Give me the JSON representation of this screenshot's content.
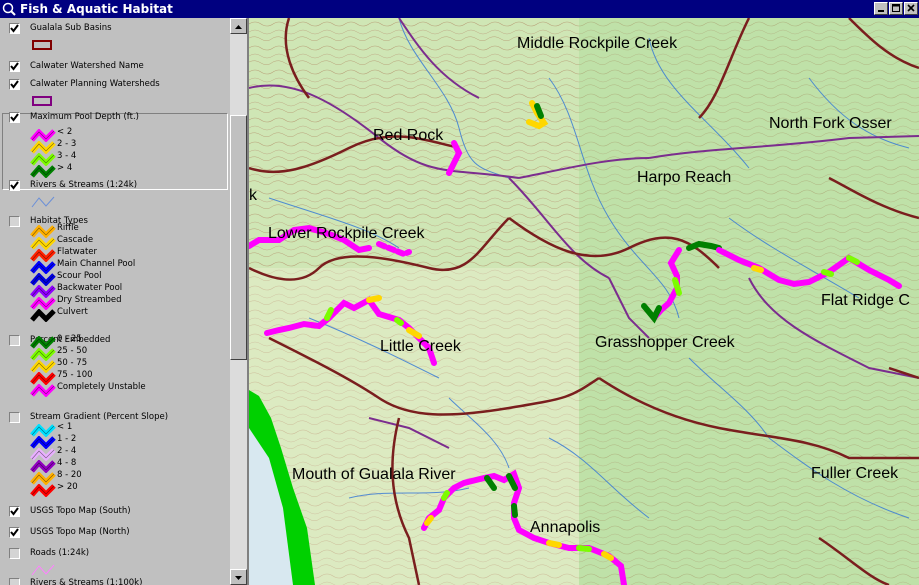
{
  "window": {
    "title": "Fish & Aquatic Habitat"
  },
  "legend": {
    "layers": [
      {
        "name": "Gualala Sub Basins",
        "checked": true,
        "symbol": "polygon",
        "color": "#800000"
      },
      {
        "name": "Calwater Watershed Name",
        "checked": true
      },
      {
        "name": "Calwater Planning Watersheds",
        "checked": true,
        "symbol": "polygon",
        "color": "#800080"
      },
      {
        "name": "Maximum Pool Depth (ft.)",
        "checked": true,
        "items": [
          {
            "label": "< 2",
            "color": "#ff00ff"
          },
          {
            "label": "2 - 3",
            "color": "#ffd700"
          },
          {
            "label": "3 - 4",
            "color": "#7cfc00"
          },
          {
            "label": "> 4",
            "color": "#008000"
          }
        ]
      },
      {
        "name": "Rivers & Streams (1:24k)",
        "checked": true,
        "symbol": "line",
        "color": "#6a8fd8"
      },
      {
        "name": "Habitat Types",
        "checked": false,
        "items": [
          {
            "label": "Riffle",
            "color": "#ffb000"
          },
          {
            "label": "Cascade",
            "color": "#ffd700"
          },
          {
            "label": "Flatwater",
            "color": "#ff2000"
          },
          {
            "label": "Main Channel Pool",
            "color": "#0000ff"
          },
          {
            "label": "Scour Pool",
            "color": "#0000e0"
          },
          {
            "label": "Backwater Pool",
            "color": "#9000ff"
          },
          {
            "label": "Dry Streambed",
            "color": "#ff00ff"
          },
          {
            "label": "Culvert",
            "color": "#000000"
          }
        ]
      },
      {
        "name": "Percent Embedded",
        "checked": false,
        "items": [
          {
            "label": "0 - 25",
            "color": "#008000"
          },
          {
            "label": "25 - 50",
            "color": "#7cfc00"
          },
          {
            "label": "50 - 75",
            "color": "#ffd700"
          },
          {
            "label": "75 - 100",
            "color": "#ff0000"
          },
          {
            "label": "Completely Unstable",
            "color": "#ff00ff"
          }
        ]
      },
      {
        "name": "Stream Gradient (Percent Slope)",
        "checked": false,
        "items": [
          {
            "label": "< 1",
            "color": "#00e0ff"
          },
          {
            "label": "1 - 2",
            "color": "#0000ff"
          },
          {
            "label": "2 - 4",
            "color": "#e8b0ff"
          },
          {
            "label": "4 - 8",
            "color": "#9000c0"
          },
          {
            "label": "8 - 20",
            "color": "#ffb000"
          },
          {
            "label": "> 20",
            "color": "#ff0000"
          }
        ]
      },
      {
        "name": "USGS Topo Map (South)",
        "checked": true
      },
      {
        "name": "USGS Topo Map (North)",
        "checked": true
      },
      {
        "name": "Roads (1:24k)",
        "checked": false,
        "symbol": "line",
        "color": "#ff80ff"
      },
      {
        "name": "Rivers & Streams (1:100k)",
        "checked": false
      }
    ]
  },
  "map": {
    "labels": [
      {
        "text": "Middle Rockpile Creek"
      },
      {
        "text": "Red Rock"
      },
      {
        "text": "North Fork Osser"
      },
      {
        "text": "Harpo Reach"
      },
      {
        "text": "k"
      },
      {
        "text": "Lower Rockpile Creek"
      },
      {
        "text": "Flat Ridge C"
      },
      {
        "text": "Grasshopper Creek"
      },
      {
        "text": "Little Creek"
      },
      {
        "text": "Mouth of Gualala River"
      },
      {
        "text": "Fuller Creek"
      },
      {
        "text": "Annapolis"
      }
    ],
    "colors": {
      "land": "#cfe6b5",
      "subbasin": "#7a1e1e",
      "watershed": "#7b2d8e",
      "stream": "#3a7bd5",
      "ocean_shore": "#00d000",
      "ocean": "#d8e8f0"
    }
  }
}
